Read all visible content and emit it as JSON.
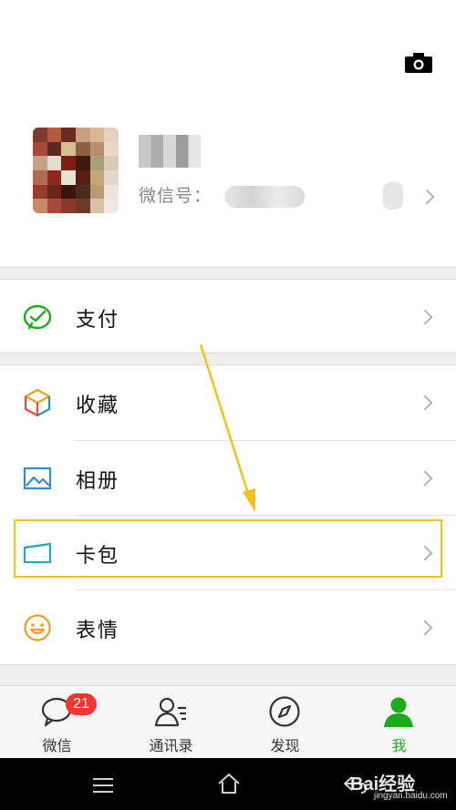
{
  "header": {
    "camera_icon": "camera-icon"
  },
  "profile": {
    "wechat_id_label": "微信号：",
    "avatar_colors": [
      "#7d3a2e",
      "#b45a3f",
      "#6b2b22",
      "#c9a080",
      "#d8b896",
      "#e7cfc0",
      "#a9483a",
      "#5a2a1e",
      "#d4c090",
      "#8c6040",
      "#b89070",
      "#e9d7c9",
      "#c6a18a",
      "#e2dccc",
      "#7a1e16",
      "#3f1a10",
      "#a8a076",
      "#d8cbb8",
      "#b06a54",
      "#8e2a1c",
      "#e6e2d4",
      "#5b1d12",
      "#c2a878",
      "#e4d8cc",
      "#9a3a2c",
      "#6a2518",
      "#3c140c",
      "#4a2c1c",
      "#b89a74",
      "#efe4da",
      "#c88a6a",
      "#a64a3a",
      "#8a3a2a",
      "#6c3a28",
      "#d6c2a8",
      "#f1e9e2"
    ]
  },
  "menu": {
    "pay": {
      "label": "支付",
      "icon": "wechat-pay-icon",
      "color": "#1aad19"
    },
    "favorites": {
      "label": "收藏",
      "icon": "favorites-cube-icon"
    },
    "album": {
      "label": "相册",
      "icon": "album-image-icon",
      "color": "#2e8fd8"
    },
    "cards": {
      "label": "卡包",
      "icon": "card-wallet-icon",
      "color": "#2aa6c6"
    },
    "stickers": {
      "label": "表情",
      "icon": "smiley-icon",
      "color": "#f0a020"
    }
  },
  "annotation": {
    "highlight_color": "#f0c419"
  },
  "tabbar": {
    "tabs": [
      {
        "label": "微信",
        "icon": "chat-bubble-icon",
        "badge": "21"
      },
      {
        "label": "通讯录",
        "icon": "contacts-icon"
      },
      {
        "label": "发现",
        "icon": "discover-compass-icon"
      },
      {
        "label": "我",
        "icon": "me-person-icon",
        "active": true
      }
    ],
    "active_color": "#1aad19",
    "badge_color": "#f43530"
  },
  "system_nav": {
    "icons": [
      "menu-icon",
      "home-icon",
      "back-icon"
    ]
  },
  "watermark": {
    "main": "Bai经验",
    "sub": "jingyan.baidu.com"
  }
}
